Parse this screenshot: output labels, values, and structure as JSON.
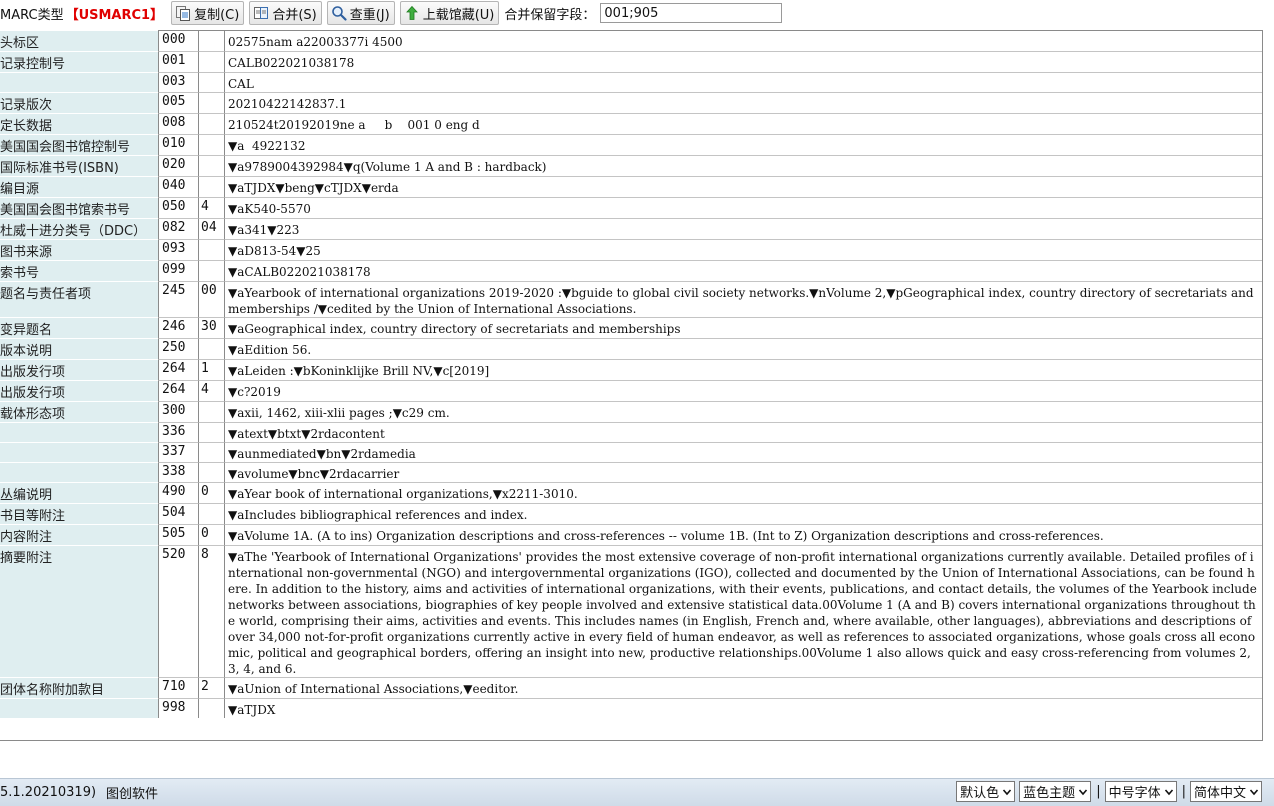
{
  "toolbar": {
    "marc_label": "MARC类型",
    "marc_type": "【USMARC1】",
    "copy": "复制(C)",
    "merge": "合并(S)",
    "dedup": "查重(J)",
    "upload": "上载馆藏(U)",
    "retain_label": "合并保留字段：",
    "retain_value": "001;905"
  },
  "record": [
    {
      "name": "头标区",
      "tag": "000",
      "ind": "",
      "data": "02575nam a22003377i 4500"
    },
    {
      "name": "记录控制号",
      "tag": "001",
      "ind": "",
      "data": "CALB022021038178"
    },
    {
      "name": "",
      "tag": "003",
      "ind": "",
      "data": "CAL"
    },
    {
      "name": "记录版次",
      "tag": "005",
      "ind": "",
      "data": "20210422142837.1"
    },
    {
      "name": "定长数据",
      "tag": "008",
      "ind": "",
      "data": "210524t20192019ne a     b    001 0 eng d"
    },
    {
      "name": "美国国会图书馆控制号",
      "tag": "010",
      "ind": "",
      "data": "▼a  4922132"
    },
    {
      "name": "国际标准书号(ISBN)",
      "tag": "020",
      "ind": "",
      "data": "▼a9789004392984▼q(Volume 1 A and B : hardback)"
    },
    {
      "name": "编目源",
      "tag": "040",
      "ind": "",
      "data": "▼aTJDX▼beng▼cTJDX▼erda"
    },
    {
      "name": "美国国会图书馆索书号",
      "tag": "050",
      "ind": " 4",
      "data": "▼aK540-5570"
    },
    {
      "name": "杜威十进分类号（DDC）",
      "tag": "082",
      "ind": "04",
      "data": "▼a341▼223"
    },
    {
      "name": "图书来源",
      "tag": "093",
      "ind": "",
      "data": "▼aD813-54▼25"
    },
    {
      "name": "索书号",
      "tag": "099",
      "ind": "",
      "data": "▼aCALB022021038178"
    },
    {
      "name": "题名与责任者项",
      "tag": "245",
      "ind": "00",
      "data": "▼aYearbook of international organizations 2019-2020 :▼bguide to global civil society networks.▼nVolume 2,▼pGeographical index, country directory of secretariats and memberships /▼cedited by the Union of International Associations."
    },
    {
      "name": "变异题名",
      "tag": "246",
      "ind": "30",
      "data": "▼aGeographical index, country directory of secretariats and memberships"
    },
    {
      "name": "版本说明",
      "tag": "250",
      "ind": "",
      "data": "▼aEdition 56."
    },
    {
      "name": "出版发行项",
      "tag": "264",
      "ind": " 1",
      "data": "▼aLeiden :▼bKoninklijke Brill NV,▼c[2019]"
    },
    {
      "name": "出版发行项",
      "tag": "264",
      "ind": " 4",
      "data": "▼c?2019"
    },
    {
      "name": "载体形态项",
      "tag": "300",
      "ind": "",
      "data": "▼axii, 1462, xiii-xlii pages ;▼c29 cm."
    },
    {
      "name": "",
      "tag": "336",
      "ind": "",
      "data": "▼atext▼btxt▼2rdacontent"
    },
    {
      "name": "",
      "tag": "337",
      "ind": "",
      "data": "▼aunmediated▼bn▼2rdamedia"
    },
    {
      "name": "",
      "tag": "338",
      "ind": "",
      "data": "▼avolume▼bnc▼2rdacarrier"
    },
    {
      "name": "丛编说明",
      "tag": "490",
      "ind": "0",
      "data": "▼aYear book of international organizations,▼x2211-3010."
    },
    {
      "name": "书目等附注",
      "tag": "504",
      "ind": "",
      "data": "▼aIncludes bibliographical references and index."
    },
    {
      "name": "内容附注",
      "tag": "505",
      "ind": "0",
      "data": "▼aVolume 1A. (A to ins) Organization descriptions and cross-references -- volume 1B. (Int to Z) Organization descriptions and cross-references."
    },
    {
      "name": "摘要附注",
      "tag": "520",
      "ind": "8",
      "data": "▼aThe 'Yearbook of International Organizations' provides the most extensive coverage of non-profit international organizations currently available. Detailed profiles of international non-governmental (NGO) and intergovernmental organizations (IGO), collected and documented by the Union of International Associations, can be found here. In addition to the history, aims and activities of international organizations, with their events, publications, and contact details, the volumes of the Yearbook include networks between associations, biographies of key people involved and extensive statistical data.00Volume 1 (A and B) covers international organizations throughout the world, comprising their aims, activities and events. This includes names (in English, French and, where available, other languages), abbreviations and descriptions of over 34,000 not-for-profit organizations currently active in every field of human endeavor, as well as references to associated organizations, whose goals cross all economic, political and geographical borders, offering an insight into new, productive relationships.00Volume 1 also allows quick and easy cross-referencing from volumes 2, 3, 4, and 6."
    },
    {
      "name": "团体名称附加款目",
      "tag": "710",
      "ind": "2",
      "data": "▼aUnion of International Associations,▼eeditor."
    },
    {
      "name": "",
      "tag": "998",
      "ind": "",
      "data": "▼aTJDX"
    }
  ],
  "statusbar": {
    "version": "5.1.20210319)",
    "software": "图创软件",
    "select_color": "默认色",
    "select_theme": "蓝色主题",
    "select_font": "中号字体",
    "select_lang": "简体中文",
    "separator": "|"
  }
}
